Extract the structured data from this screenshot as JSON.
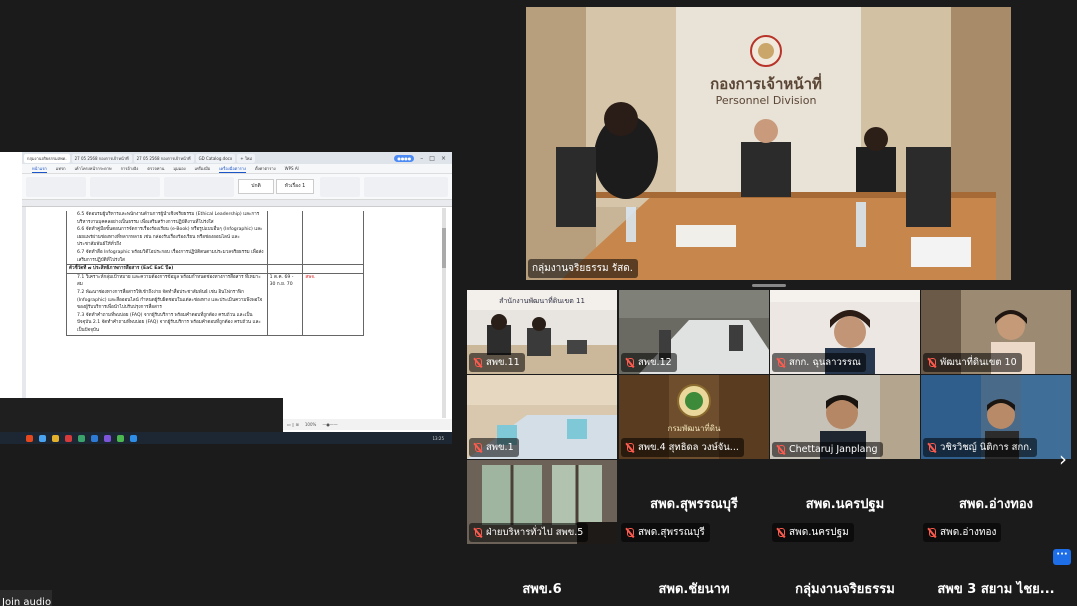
{
  "shared_screen": {
    "tabs": [
      "กลุ่มงานจริยธรรมสพด.",
      "27 05 2568 กองการเจ้าหน้าที่",
      "27 05 2568 กองการเจ้าหน้าที่",
      "GD Catalog.docx",
      "+ ใหม่"
    ],
    "menu": [
      "หน้าแรก",
      "แทรก",
      "เค้าโครงหน้ากระดาษ",
      "การอ้างอิง",
      "ตรวจทาน",
      "มุมมอง",
      "เครื่องมือ",
      "เครื่องมือตาราง",
      "ตั้งค่าตาราง",
      "WPS AI"
    ],
    "style_normal": "ปกติ",
    "style_heading": "หัวเรื่อง 1",
    "doc_rows": [
      {
        "text": "6.5 จัดอบรมผู้บริหารและพนักงานด้านการผู้นำเชิงจริยธรรม (Ethical Leadership) และการบริหารงานบุคคลอย่างเป็นธรรม เพื่อเสริมสร้างการปฏิบัติงานที่โปร่งใส"
      },
      {
        "text": "6.6 จัดทำคู่มือขั้นตอนการจัดการเรื่องร้องเรียน (e-Book) หรือรูปแบบอื่นๆ (Infographic) และเผยแพร่ผ่านช่องทางที่หลากหลาย เช่น กล่องรับเรื่องร้องเรียน หรือช่องออนไลน์ และประชาสัมพันธ์ให้ทั่วถึง"
      },
      {
        "text": "6.7 จัดทำสื่อ Infographic พร้อมวิดีโอประกอบ เรื่องการปฏิบัติตนตามประมวลจริยธรรม เพื่อส่งเสริมการปฏิบัติที่โปร่งใส"
      }
    ],
    "section_head": "ตัวชี้วัดที่ ๗ ประสิทธิภาพการสื่อสาร (EaC EaC ปี๑)",
    "doc_rows2": [
      {
        "text": "7.1 วิเคราะห์กลุ่มเป้าหมาย และความต้องการข้อมูล พร้อมกำหนดช่องทางการสื่อสาร ที่เหมาะสม",
        "date": "1 ต.ค. 69 - 30 ก.ย. 70",
        "owner": "สพจ."
      },
      {
        "text": "7.2 พัฒนาช่องทางการสื่อสารให้เข้าถึงง่าย จัดทำสื่อประชาสัมพันธ์ เช่น อินโฟกราฟิก (Infographic) และสื่อออนไลน์ กำหนดผู้รับผิดชอบในแต่ละช่องทาง และประเมินความพึงพอใจของผู้รับบริการเพื่อนำไปปรับปรุงการสื่อสาร",
        "date": "",
        "owner": ""
      },
      {
        "text": "7.3 จัดทำคำถามที่พบบ่อย (FAQ) จากผู้รับบริการ พร้อมคำตอบที่ถูกต้อง ครบถ้วน และเป็นปัจจุบัน 2.1 จัดทำคำถามที่พบบ่อย (FAQ) จากผู้รับบริการ พร้อมคำตอบที่ถูกต้อง ครบถ้วน และเป็นปัจจุบัน",
        "date": "",
        "owner": ""
      }
    ],
    "zoom": "100%",
    "clock": "13:25"
  },
  "main_camera": {
    "sign_th": "กองการเจ้าหน้าที่",
    "sign_en": "Personnel Division",
    "label": "กลุ่มงานจริยธรรม รัสด."
  },
  "gallery_labels": {
    "t1": "สพข.11",
    "t2": "สพข.12",
    "t3": "สกก. ฉุนลาวรรณ",
    "t4": "พัฒนาที่ดินเขต 10",
    "t5": "สพข.1",
    "t6": "สพข.4 สุทธิดล วงษ์จัน...",
    "t7": "Chettaruj Janplang",
    "t8": "วชิรวิชญ์ นิติการ สกก.",
    "t9": "ฝ่ายบริหารทั่วไป สพข.5",
    "t10": "สพด.สุพรรณบุรี",
    "t11": "สพด.นครปฐม",
    "t12": "สพด.อ่างทอง"
  },
  "name_tiles": {
    "n10": "สพด.สุพรรณบุรี",
    "n11": "สพด.นครปฐม",
    "n12": "สพด.อ่างทอง"
  },
  "tile_signs": {
    "office11": "สำนักงานพัฒนาที่ดินเขต 11",
    "logo_caption": "กรมพัฒนาที่ดิน"
  },
  "bottom_row": [
    "สพข.6",
    "สพด.ชัยนาท",
    "กลุ่มงานจริยธรรม",
    "สพข 3 สยาม ไชย..."
  ],
  "join_audio": "Join audio",
  "more_icon": "···"
}
